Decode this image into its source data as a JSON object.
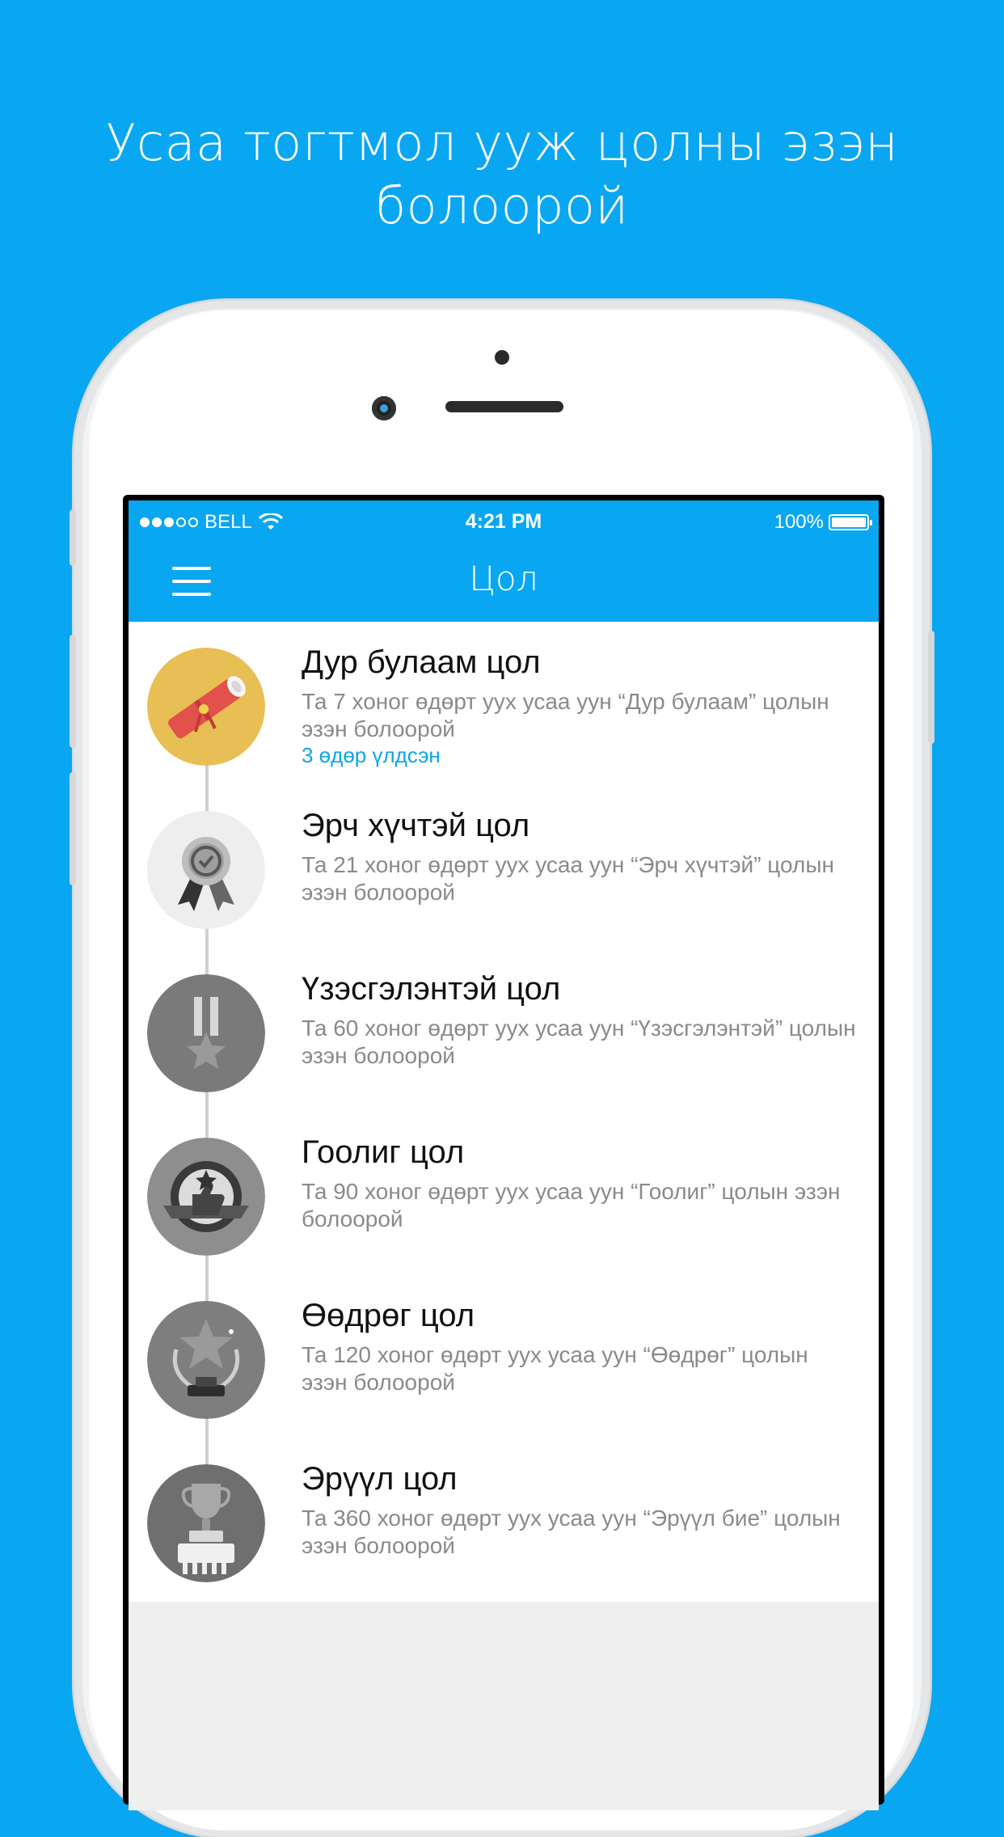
{
  "headline": {
    "line1": "Усаа тогтмол ууж цолны эзэн",
    "line2": "болоорой"
  },
  "status_bar": {
    "carrier": "BELL",
    "time": "4:21 PM",
    "battery": "100%",
    "signal_bars_filled": 3,
    "signal_bars_total": 5
  },
  "navbar": {
    "title": "Цол",
    "menu_icon": "hamburger-menu-icon"
  },
  "titles": [
    {
      "name": "Дур булаам цол",
      "description": "Та 7 хоног өдөрт уух усаа уун “Дур булаам” цолын эзэн болоорой",
      "status": "3 өдөр үлдсэн",
      "icon": "scroll-diploma-icon",
      "color": "#e8bf54"
    },
    {
      "name": "Эрч хүчтэй цол",
      "description": "Та 21 хоног өдөрт уух усаа уун “Эрч хүчтэй” цолын эзэн болоорой",
      "icon": "award-ribbon-icon",
      "color": "#eeeeee"
    },
    {
      "name": "Үзэсгэлэнтэй цол",
      "description": "Та 60 хоног өдөрт уух усаа уун “Үзэсгэлэнтэй” цолын эзэн болоорой",
      "icon": "star-medal-icon",
      "color": "#7a7a7a"
    },
    {
      "name": "Гоолиг цол",
      "description": "Та 90 хоног өдөрт уух усаа уун “Гоолиг” цолын эзэн болоорой",
      "icon": "thumbs-up-badge-icon",
      "color": "#8e8e8e"
    },
    {
      "name": "Өөдрөг цол",
      "description": "Та 120 хоног өдөрт уух усаа уун “Өөдрөг” цолын эзэн болоорой",
      "icon": "laurel-star-trophy-icon",
      "color": "#7e7e7e"
    },
    {
      "name": "Эрүүл цол",
      "description": "Та 360 хоног өдөрт уух усаа уун “Эрүүл бие” цолын эзэн болоорой",
      "icon": "trophy-cup-icon",
      "color": "#6f6f6f"
    }
  ]
}
